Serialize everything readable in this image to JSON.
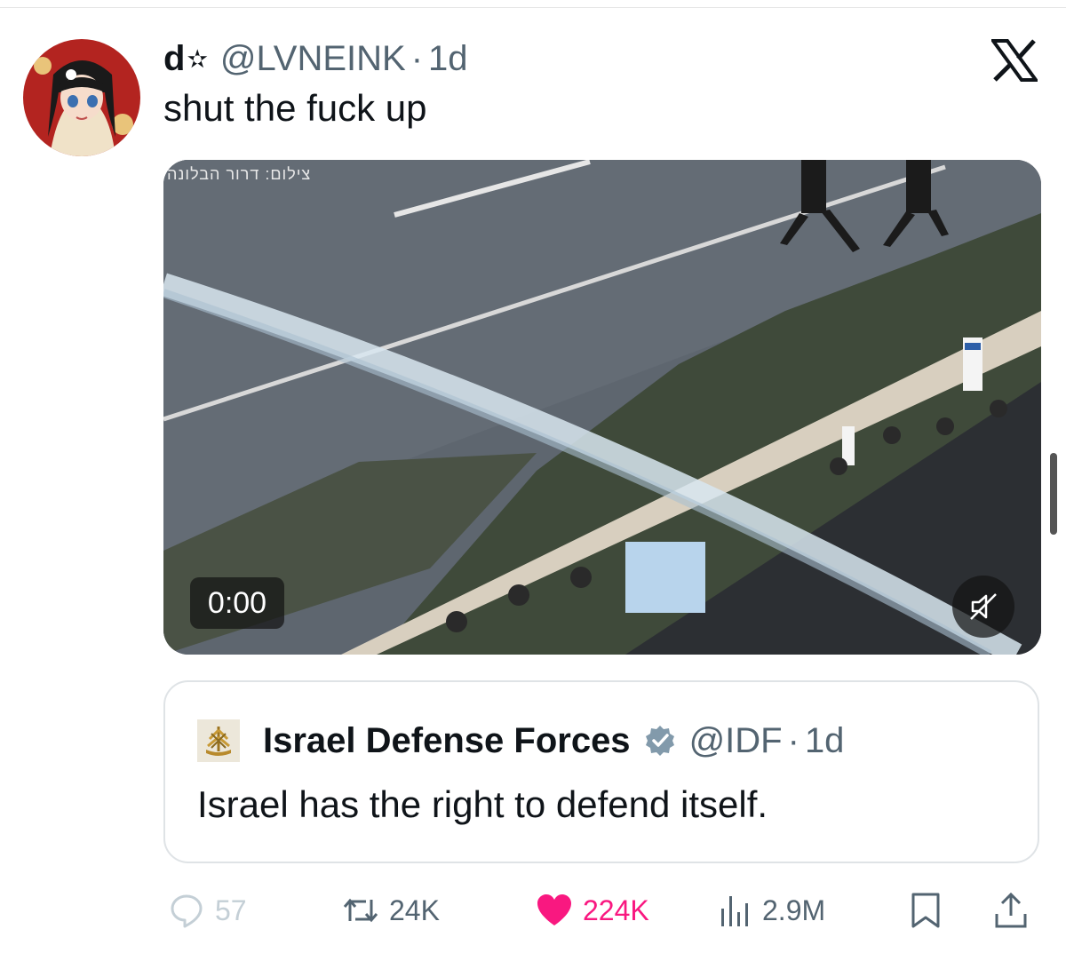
{
  "tweet": {
    "display_name": "d",
    "name_star": "✫",
    "handle": "@LVNEINK",
    "separator": "·",
    "time": "1d",
    "text": "shut the fuck up",
    "avatar_icon": "anime-avatar"
  },
  "media": {
    "watermark": "צילום: דרור הבלונה",
    "timestamp": "0:00",
    "mute_icon": "muted-speaker-icon"
  },
  "quote": {
    "display_name": "Israel Defense Forces",
    "verified_icon": "verified-badge-icon",
    "handle": "@IDF",
    "separator": "·",
    "time": "1d",
    "text": "Israel has the right to defend itself.",
    "verified_color": "#829aab"
  },
  "actions": {
    "replies": "57",
    "retweets": "24K",
    "likes": "224K",
    "views": "2.9M"
  },
  "colors": {
    "text": "#0f1419",
    "secondary": "#536471",
    "like": "#f91880",
    "border": "#dfe3e6"
  },
  "brand": {
    "logo_icon": "x-logo-icon"
  }
}
